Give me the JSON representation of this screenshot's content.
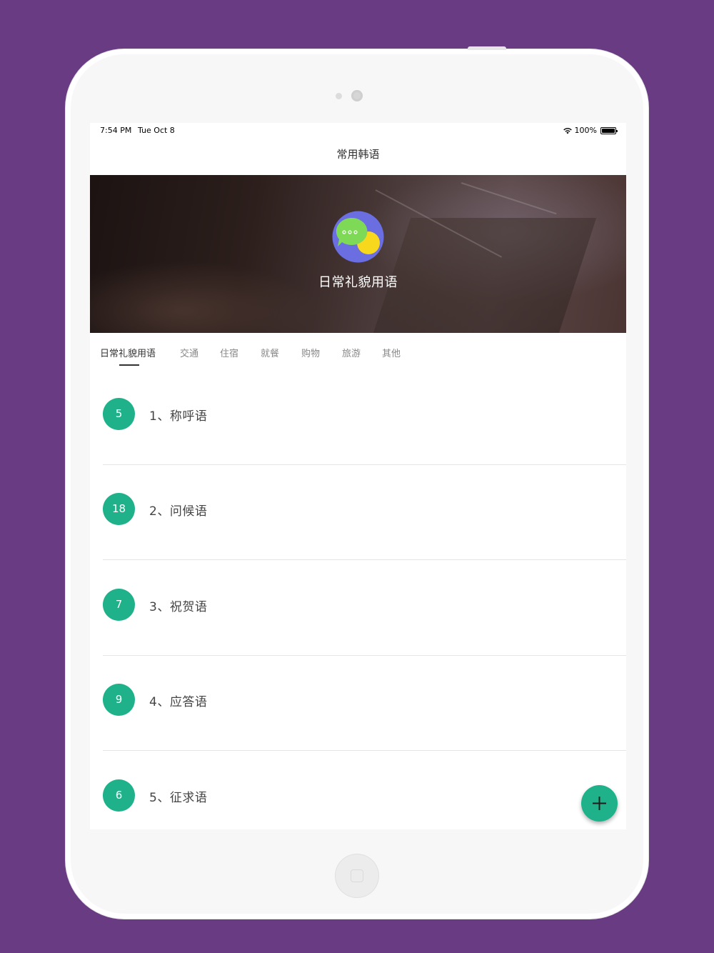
{
  "status_bar": {
    "time": "7:54 PM",
    "date": "Tue Oct 8",
    "battery": "100%",
    "battery_level": 1.0
  },
  "nav": {
    "title": "常用韩语"
  },
  "banner": {
    "title": "日常礼貌用语"
  },
  "tabs": [
    {
      "label": "日常礼貌用语",
      "active": true
    },
    {
      "label": "交通"
    },
    {
      "label": "住宿"
    },
    {
      "label": "就餐"
    },
    {
      "label": "购物"
    },
    {
      "label": "旅游"
    },
    {
      "label": "其他"
    }
  ],
  "items": [
    {
      "count": "5",
      "label": "1、称呼语"
    },
    {
      "count": "18",
      "label": "2、问候语"
    },
    {
      "count": "7",
      "label": "3、祝贺语"
    },
    {
      "count": "9",
      "label": "4、应答语"
    },
    {
      "count": "6",
      "label": "5、征求语"
    }
  ],
  "colors": {
    "accent": "#1fb28a",
    "background": "#683b82",
    "icon_circle": "#6a6ee0",
    "icon_bubble_green": "#7ed957",
    "icon_bubble_yellow": "#f8d81c"
  },
  "icons": {
    "banner": "chat-bubbles-icon",
    "fab": "plus-icon",
    "status": [
      "wifi-icon",
      "battery-icon"
    ]
  }
}
